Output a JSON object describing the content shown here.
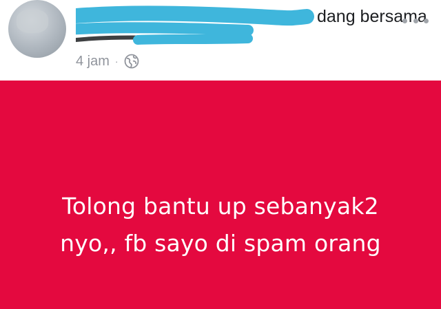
{
  "post": {
    "author_text_visible": "dang bersama",
    "timestamp": "4 jam",
    "separator": "·",
    "privacy_icon": "globe-icon",
    "more_icon": "more-horizontal-icon"
  },
  "status": {
    "background_color": "#e4093f",
    "text_color": "#ffffff",
    "lines": [
      "Tolong bantu up sebanyak2",
      "nyo,, fb sayo di spam orang"
    ]
  },
  "colors": {
    "redaction_scribble": "#3fb6dc",
    "meta_text": "#90949c"
  }
}
